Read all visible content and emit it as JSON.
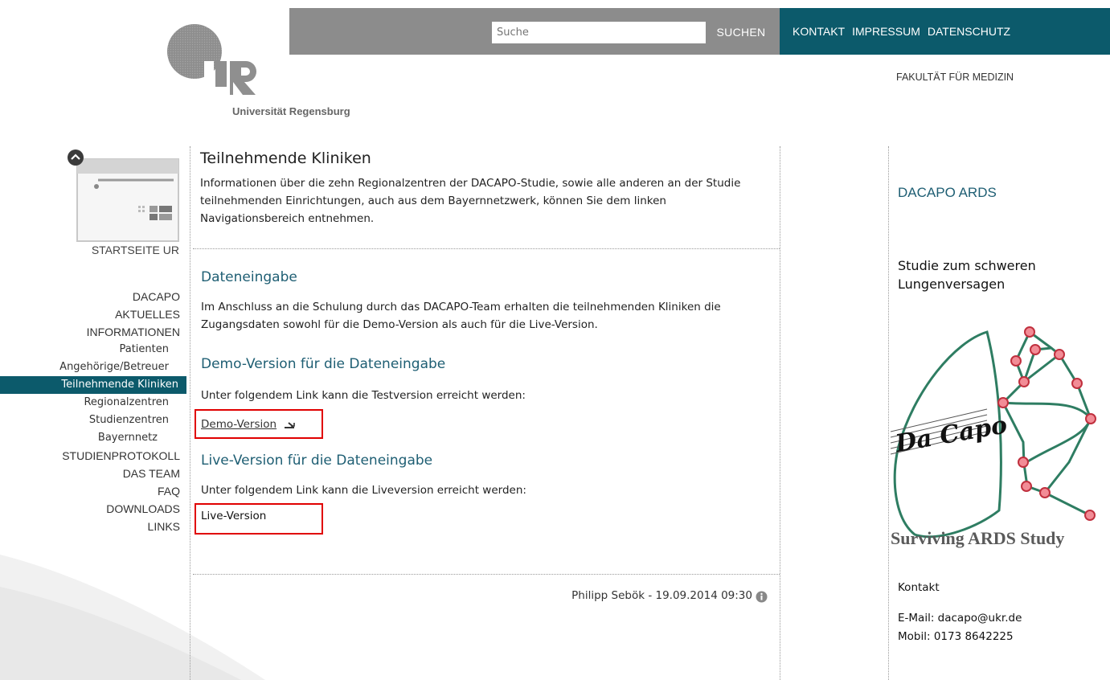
{
  "header": {
    "search_placeholder": "Suche",
    "search_button": "SUCHEN",
    "links": [
      "KONTAKT",
      "IMPRESSUM",
      "DATENSCHUTZ"
    ],
    "faculty": "FAKULTÄT FÜR MEDIZIN",
    "logo_caption": "Universität Regensburg",
    "colors": {
      "gray_bar": "#8c8c8c",
      "teal": "#0c5a6b"
    }
  },
  "sidebar": {
    "start_label": "STARTSEITE UR",
    "items": [
      {
        "label": "DACAPO"
      },
      {
        "label": "AKTUELLES"
      },
      {
        "label": "INFORMATIONEN"
      },
      {
        "label": "Patienten"
      },
      {
        "label": "Angehörige/Betreuer"
      },
      {
        "label": "Teilnehmende Kliniken"
      },
      {
        "label": "Regionalzentren"
      },
      {
        "label": "Studienzentren"
      },
      {
        "label": "Bayernnetz"
      },
      {
        "label": "STUDIENPROTOKOLL"
      },
      {
        "label": "DAS TEAM"
      },
      {
        "label": "FAQ"
      },
      {
        "label": "DOWNLOADS"
      },
      {
        "label": "LINKS"
      }
    ]
  },
  "main": {
    "title": "Teilnehmende Kliniken",
    "intro": "Informationen über die zehn Regionalzentren der DACAPO-Studie, sowie alle anderen an der Studie teilnehmenden Einrichtungen, auch aus dem Bayernnetzwerk, können Sie dem linken Navigationsbereich entnehmen.",
    "section1_title": "Dateneingabe",
    "section1_text": "Im Anschluss an die Schulung durch das DACAPO-Team erhalten die teilnehmenden Kliniken die Zugangsdaten sowohl für die Demo-Version als auch für die Live-Version.",
    "section2_title": "Demo-Version für die Dateneingabe",
    "section2_text": "Unter folgendem Link kann die Testversion erreicht werden:",
    "demo_link": "Demo-Version",
    "section3_title": "Live-Version für die Dateneingabe",
    "section3_text": "Unter folgendem Link kann die Liveversion erreicht werden:",
    "live_link": "Live-Version",
    "author": "Philipp Sebök - 19.09.2014 09:30"
  },
  "right": {
    "title": "DACAPO ARDS",
    "subtitle": "Studie zum schweren Lungenversagen",
    "logo_text": "Da Capo",
    "logo_caption": "Surviving ARDS Study",
    "contact_title": "Kontakt",
    "email": "E-Mail: dacapo@ukr.de",
    "phone": "Mobil: 0173 8642225"
  }
}
